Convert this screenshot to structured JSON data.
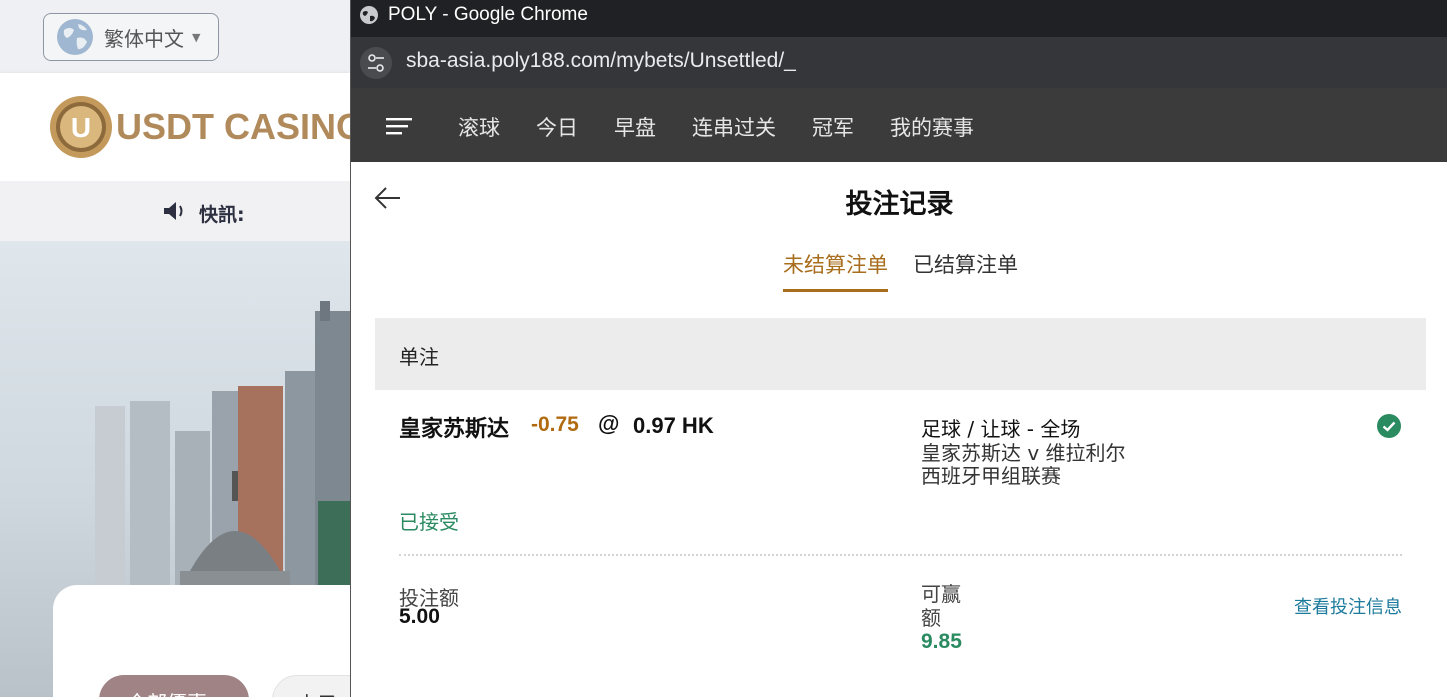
{
  "background_site": {
    "language_label": "繁体中文",
    "logo_text": "USDT CASINO",
    "logo_coin_letter": "U",
    "news_label": "快訊:",
    "chip_1_label": "全部優惠",
    "chip_2_label": "电子"
  },
  "window": {
    "title": "POLY - Google Chrome",
    "url": "sba-asia.poly188.com/mybets/Unsettled/_"
  },
  "nav": {
    "items": [
      "滚球",
      "今日",
      "早盘",
      "连串过关",
      "冠军",
      "我的赛事"
    ]
  },
  "page": {
    "title": "投注记录",
    "tabs": [
      "未结算注单",
      "已结算注单"
    ],
    "active_tab": "未结算注单",
    "section_label": "单注"
  },
  "bet": {
    "team": "皇家苏斯达",
    "handicap": "-0.75",
    "at": "@",
    "odds": "0.97 HK",
    "market": "足球 / 让球 - 全场",
    "match": "皇家苏斯达 v 维拉利尔",
    "league": "西班牙甲组联赛",
    "status": "已接受",
    "stake_label": "投注额",
    "stake_value": "5.00",
    "win_label": "可赢额",
    "win_value": "9.85",
    "view_details": "查看投注信息"
  },
  "colors": {
    "accent": "#a86d1d",
    "success": "#2a8a60",
    "link": "#1c7a9c",
    "nav_bg": "#3b3b3b"
  }
}
